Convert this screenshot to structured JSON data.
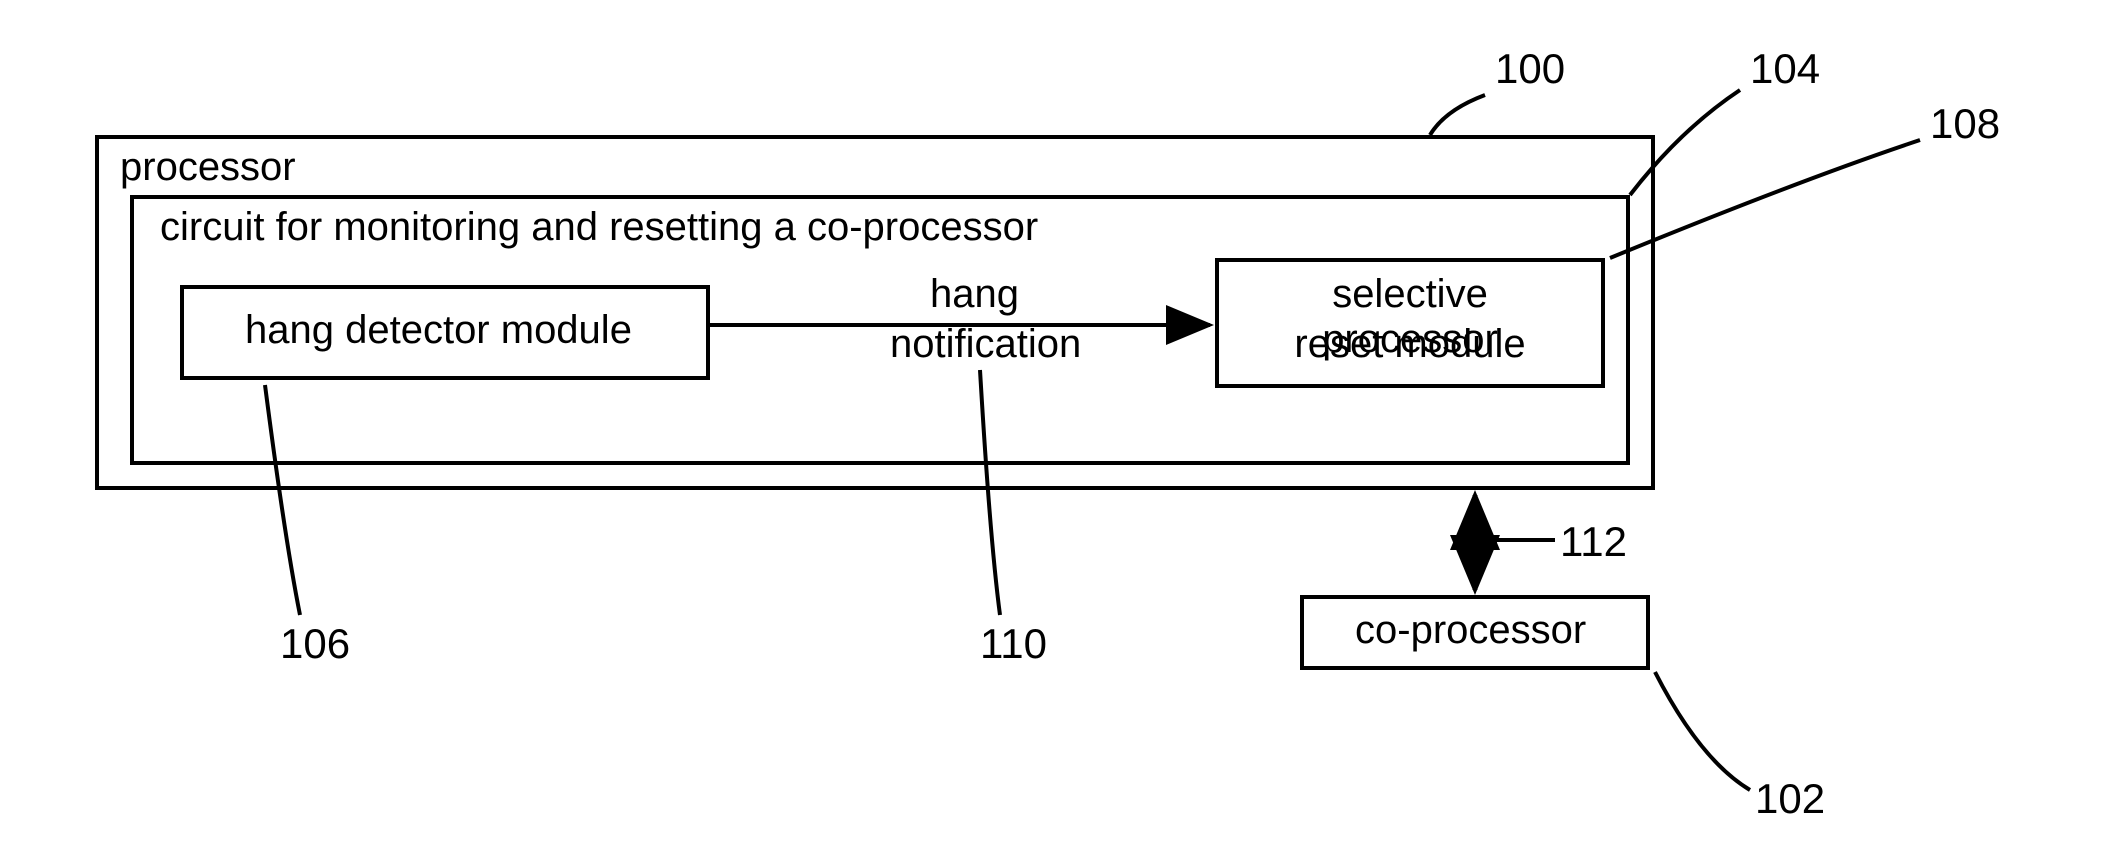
{
  "processor": {
    "label": "processor",
    "ref": "100"
  },
  "circuit": {
    "label": "circuit for monitoring and resetting a co-processor",
    "ref": "104"
  },
  "hang_detector": {
    "label": "hang detector module",
    "ref": "106"
  },
  "reset_module": {
    "line1": "selective processor",
    "line2": "reset module",
    "ref": "108"
  },
  "hang_notification": {
    "line1": "hang",
    "line2": "notification",
    "ref": "110"
  },
  "coprocessor": {
    "label": "co-processor",
    "ref": "102"
  },
  "bidir": {
    "ref": "112"
  }
}
